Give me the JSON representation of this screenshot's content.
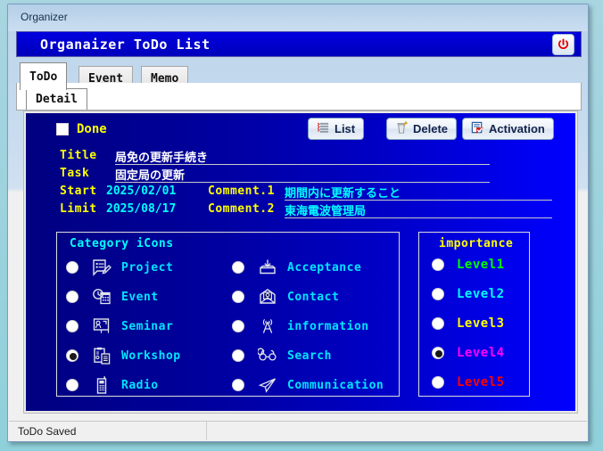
{
  "window": {
    "title": "Organizer"
  },
  "header": {
    "title": "Organaizer ToDo List",
    "power_icon": "power-icon"
  },
  "tabs": [
    {
      "label": "ToDo",
      "active": true
    },
    {
      "label": "Event",
      "active": false
    },
    {
      "label": "Memo",
      "active": false
    }
  ],
  "subtabs": [
    {
      "label": "Detail",
      "active": true
    }
  ],
  "toolbar": {
    "done_label": "Done",
    "done_checked": false,
    "list_label": "List",
    "delete_label": "Delete",
    "activation_label": "Activation",
    "list_icon": "list-icon",
    "delete_icon": "trash-icon",
    "activation_icon": "check-document-icon"
  },
  "form": {
    "title_label": "Title",
    "title_value": "局免の更新手続き",
    "task_label": "Task",
    "task_value": "固定局の更新",
    "start_label": "Start",
    "start_value": "2025/02/01",
    "limit_label": "Limit",
    "limit_value": "2025/08/17",
    "comment1_label": "Comment.1",
    "comment1_value": "期間内に更新すること",
    "comment2_label": "Comment.2",
    "comment2_value": "東海電波管理局"
  },
  "category": {
    "title": "Category iCons",
    "left_items": [
      {
        "label": "Project",
        "icon": "document-pencil-icon",
        "selected": false
      },
      {
        "label": "Event",
        "icon": "clock-calendar-icon",
        "selected": false
      },
      {
        "label": "Seminar",
        "icon": "whiteboard-icon",
        "selected": false
      },
      {
        "label": "Workshop",
        "icon": "clipboard-icon",
        "selected": true
      },
      {
        "label": "Radio",
        "icon": "handheld-radio-icon",
        "selected": false
      }
    ],
    "right_items": [
      {
        "label": "Acceptance",
        "icon": "inbox-tray-icon",
        "selected": false
      },
      {
        "label": "Contact",
        "icon": "open-envelope-icon",
        "selected": false
      },
      {
        "label": "information",
        "icon": "antenna-icon",
        "selected": false
      },
      {
        "label": "Search",
        "icon": "binoculars-icon",
        "selected": false
      },
      {
        "label": "Communication",
        "icon": "paper-plane-icon",
        "selected": false
      }
    ]
  },
  "importance": {
    "title": "importance",
    "items": [
      {
        "label": "Level1",
        "color": "#00ff00",
        "selected": false
      },
      {
        "label": "Level2",
        "color": "#00ffff",
        "selected": false
      },
      {
        "label": "Level3",
        "color": "#ffff00",
        "selected": false
      },
      {
        "label": "Level4",
        "color": "#ff00ff",
        "selected": true
      },
      {
        "label": "Level5",
        "color": "#ff0000",
        "selected": false
      }
    ]
  },
  "statusbar": {
    "message": "ToDo Saved",
    "second_cell": ""
  },
  "colors": {
    "panel_dark": "#000080",
    "panel_bright": "#0000ff",
    "header_blue": "#0000cc",
    "label_yellow": "#ffff00",
    "value_cyan": "#00ffff",
    "value_white": "#ffffff",
    "window_border": "#7a9ec2"
  }
}
